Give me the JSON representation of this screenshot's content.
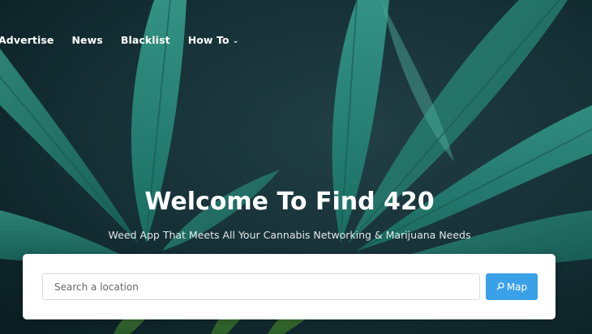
{
  "nav": {
    "items": [
      {
        "label": "Advertise"
      },
      {
        "label": "News"
      },
      {
        "label": "Blacklist"
      },
      {
        "label": "How To"
      }
    ]
  },
  "hero": {
    "title": "Welcome To Find 420",
    "subtitle": "Weed App That Meets All Your Cannabis Networking & Marijuana Needs"
  },
  "search": {
    "placeholder": "Search a location",
    "value": "",
    "button_label": "Map",
    "button_icon": "search-icon"
  },
  "colors": {
    "accent": "#3aa0e8",
    "leaf": "#2fae9a",
    "background": "#0f2a2c"
  }
}
